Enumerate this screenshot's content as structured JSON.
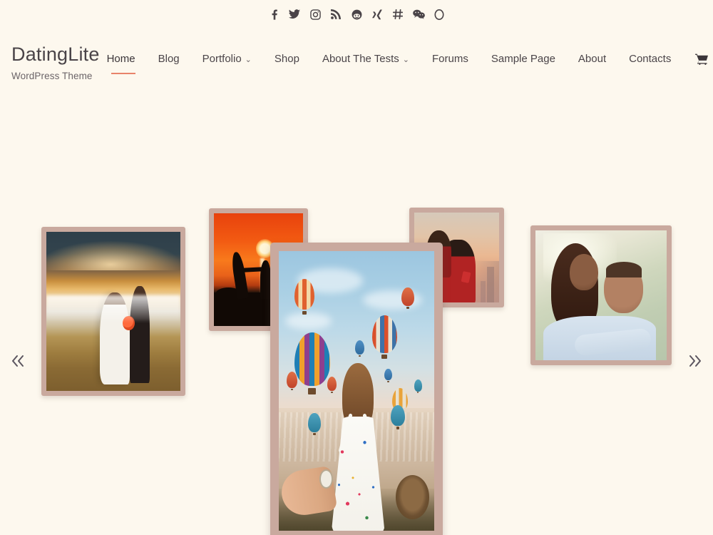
{
  "theme": {
    "background_color": "#fdf8ee",
    "accent_color": "#e8836a",
    "frame_color": "#c9a99e",
    "text_color": "#4a4448"
  },
  "social_bar": {
    "items": [
      {
        "name": "facebook-icon",
        "label": "Facebook"
      },
      {
        "name": "twitter-icon",
        "label": "Twitter"
      },
      {
        "name": "instagram-icon",
        "label": "Instagram"
      },
      {
        "name": "rss-icon",
        "label": "RSS"
      },
      {
        "name": "reddit-icon",
        "label": "Reddit"
      },
      {
        "name": "xing-icon",
        "label": "XING"
      },
      {
        "name": "slack-icon",
        "label": "Slack"
      },
      {
        "name": "wechat-icon",
        "label": "WeChat"
      },
      {
        "name": "opera-icon",
        "label": "Opera"
      }
    ]
  },
  "header": {
    "site_title": "DatingLite",
    "tagline": "WordPress Theme"
  },
  "nav": {
    "items": [
      {
        "label": "Home",
        "active": true,
        "has_submenu": false
      },
      {
        "label": "Blog",
        "active": false,
        "has_submenu": false
      },
      {
        "label": "Portfolio",
        "active": false,
        "has_submenu": true
      },
      {
        "label": "Shop",
        "active": false,
        "has_submenu": false
      },
      {
        "label": "About The Tests",
        "active": false,
        "has_submenu": true
      },
      {
        "label": "Forums",
        "active": false,
        "has_submenu": false
      },
      {
        "label": "Sample Page",
        "active": false,
        "has_submenu": false
      },
      {
        "label": "About",
        "active": false,
        "has_submenu": false
      },
      {
        "label": "Contacts",
        "active": false,
        "has_submenu": false
      }
    ],
    "caret_glyph": "⌄",
    "cart": {
      "name": "cart-icon",
      "label": "Cart"
    }
  },
  "carousel": {
    "prev_label": "«",
    "next_label": "»",
    "slides": [
      {
        "id": "slide-1",
        "alt": "Bride and groom facing each other in a misty golden sunset field",
        "position": "left"
      },
      {
        "id": "slide-2",
        "alt": "Silhouetted couple holding hands against an orange sunset over water",
        "position": "left-inner"
      },
      {
        "id": "slide-featured",
        "alt": "Woman in floral dress leading by the hand with hot air balloons over Cappadocia",
        "position": "center"
      },
      {
        "id": "slide-3",
        "alt": "Couple embracing at dusk with a city skyline behind them",
        "position": "right-inner"
      },
      {
        "id": "slide-4",
        "alt": "Smiling couple hugging outdoors in sunlight",
        "position": "right"
      }
    ]
  }
}
